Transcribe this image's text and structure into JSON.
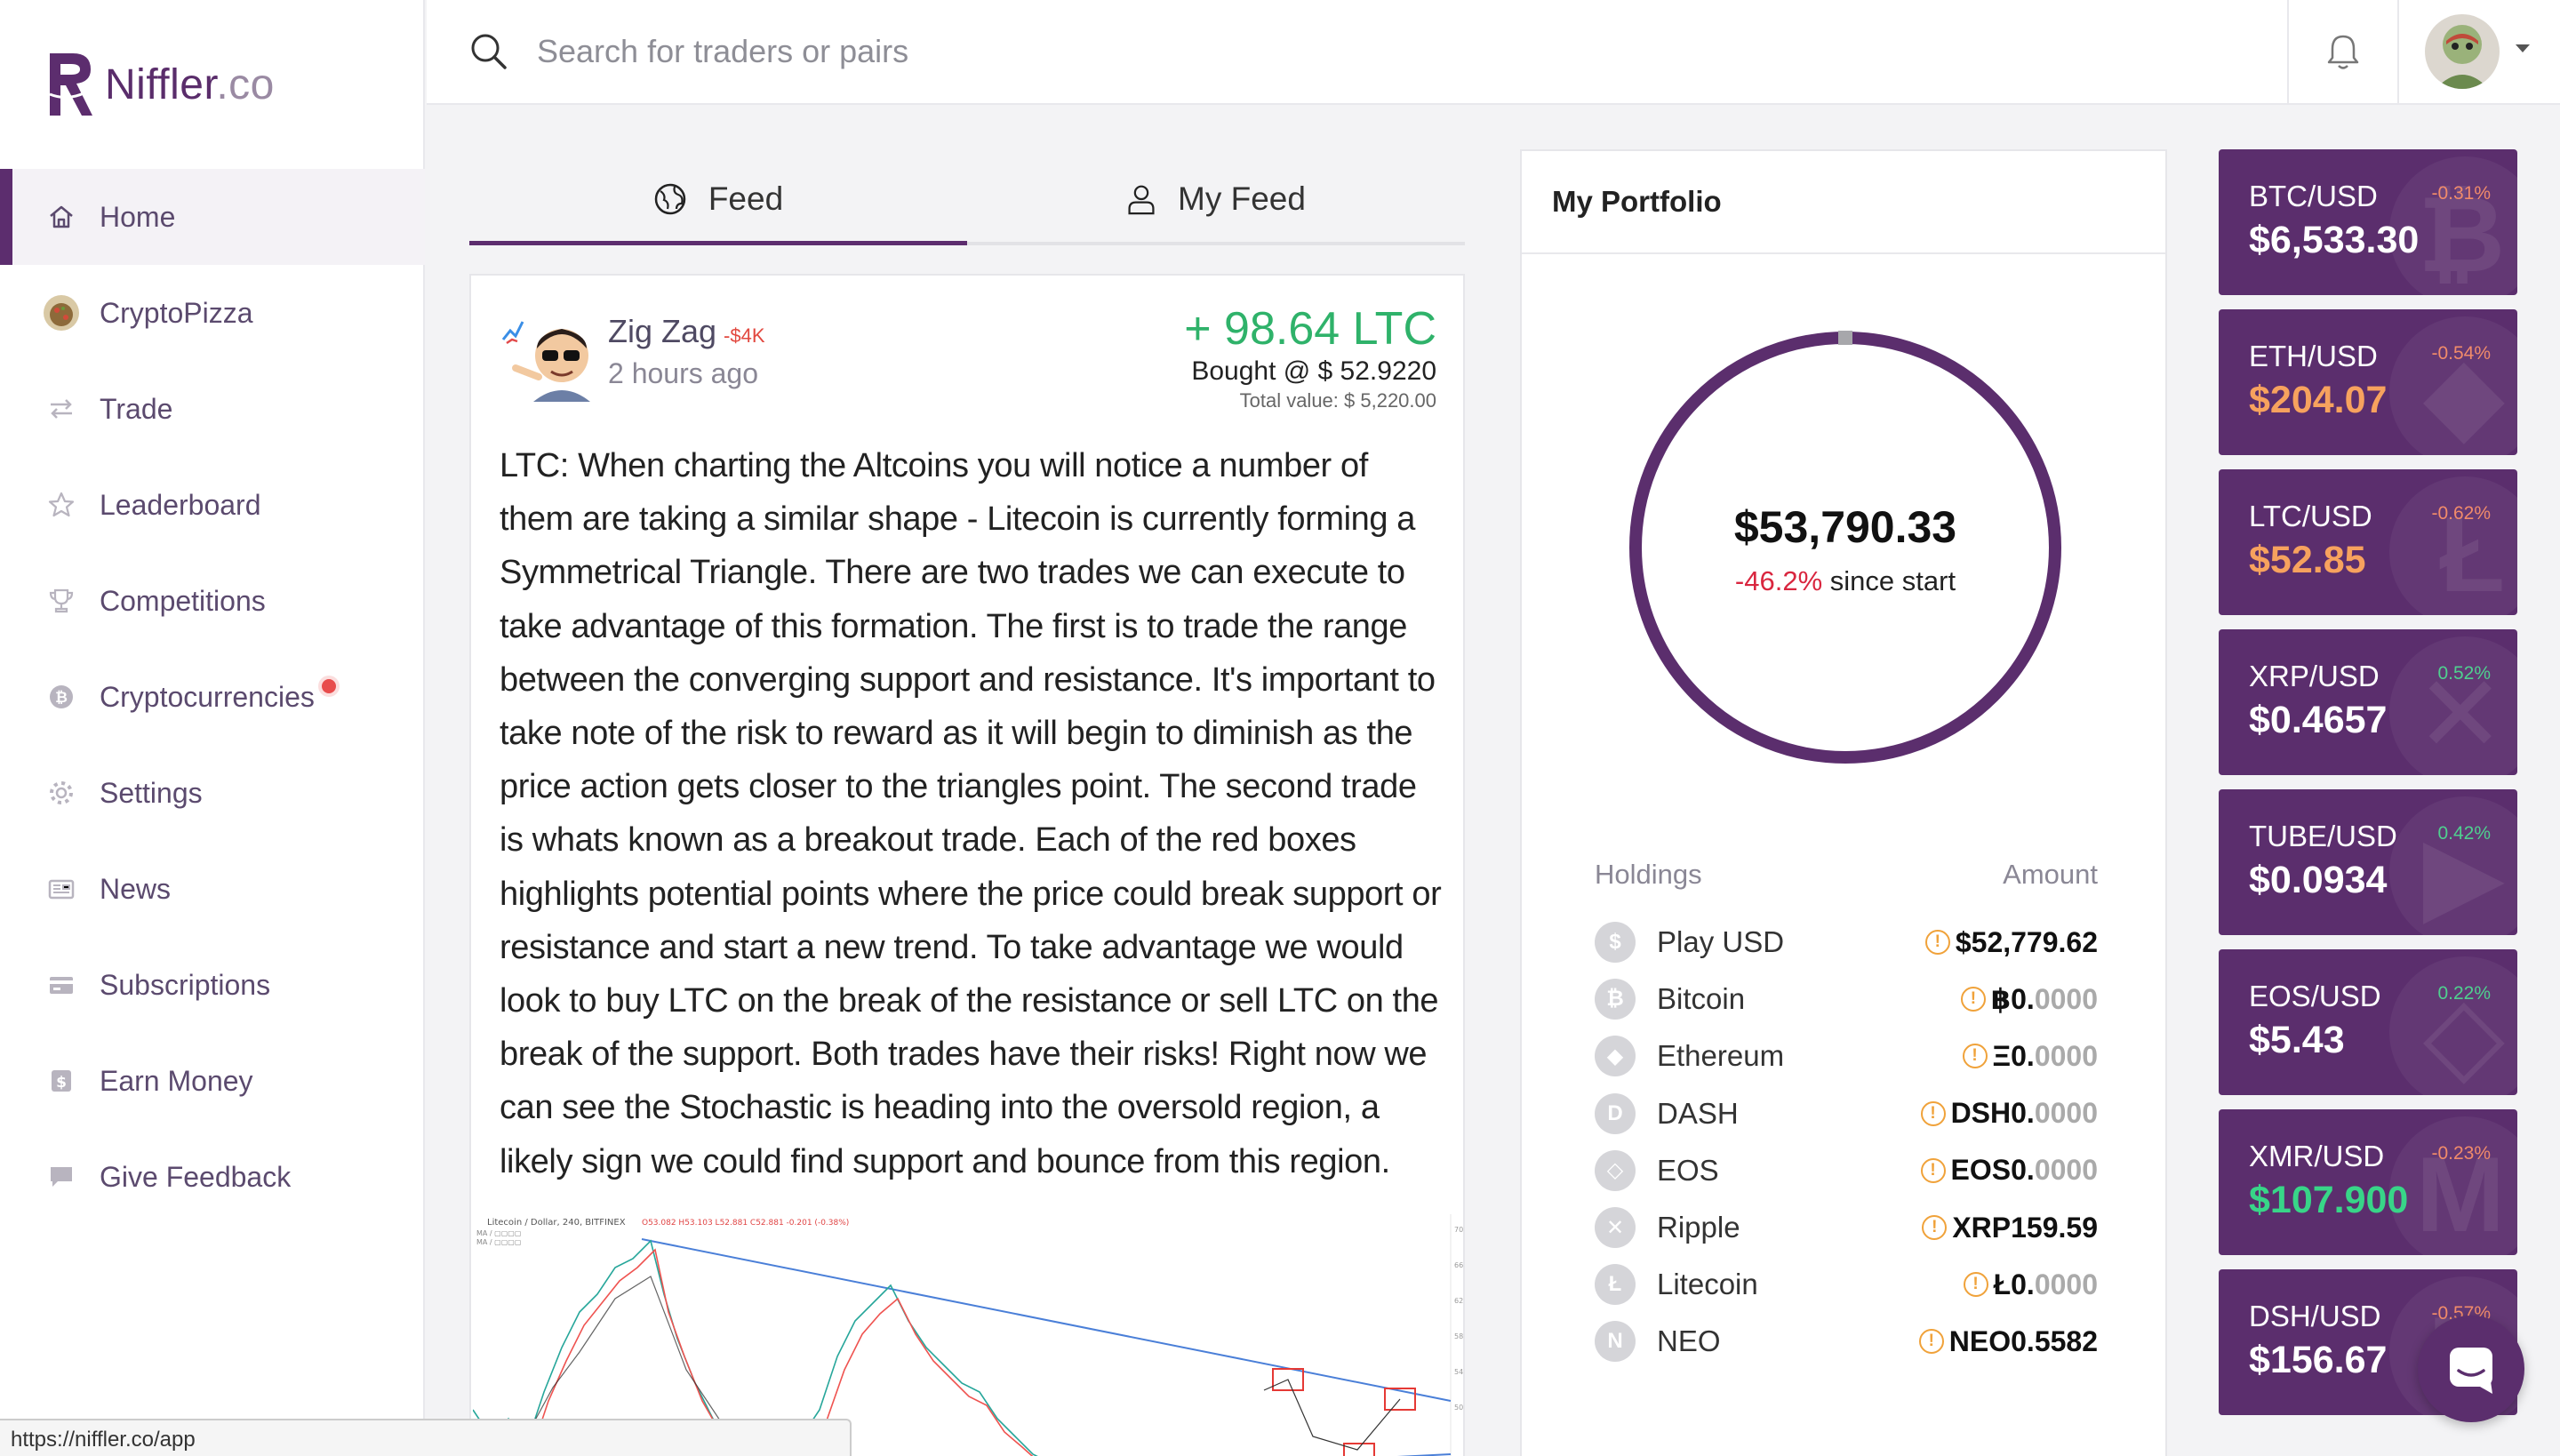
{
  "brand": {
    "name": "Niffler",
    "suffix": ".co"
  },
  "nav": [
    {
      "label": "Home",
      "icon": "home-icon",
      "active": true
    },
    {
      "label": "CryptoPizza",
      "icon": "cryptopizza-avatar-icon"
    },
    {
      "label": "Trade",
      "icon": "swap-arrows-icon"
    },
    {
      "label": "Leaderboard",
      "icon": "star-icon"
    },
    {
      "label": "Competitions",
      "icon": "trophy-icon"
    },
    {
      "label": "Cryptocurrencies",
      "icon": "bitcoin-icon",
      "badge": "red-dot"
    },
    {
      "label": "Settings",
      "icon": "gear-icon"
    },
    {
      "label": "News",
      "icon": "newspaper-icon"
    },
    {
      "label": "Subscriptions",
      "icon": "credit-card-icon"
    },
    {
      "label": "Earn Money",
      "icon": "dollar-icon"
    },
    {
      "label": "Give Feedback",
      "icon": "chat-bubble-icon"
    }
  ],
  "search": {
    "placeholder": "Search for traders or pairs"
  },
  "status_url": "https://niffler.co/app",
  "tabs": [
    {
      "label": "Feed",
      "icon": "globe-icon",
      "active": true
    },
    {
      "label": "My Feed",
      "icon": "user-icon"
    }
  ],
  "post": {
    "author": "Zig Zag",
    "author_delta": "-$4K",
    "time": "2 hours ago",
    "trade_amount": "+ 98.64 LTC",
    "bought_at": "Bought @ $ 52.9220",
    "total_value": "Total value: $ 5,220.00",
    "body": "LTC: When charting the Altcoins you will notice a number of them are taking a similar shape - Litecoin is currently forming a Symmetrical Triangle. There are two trades we can execute to take advantage of this formation. The first is to trade the range between the converging support and resistance. It's important to take note of the risk to reward as it will begin to diminish as the price action gets closer to the triangles point. The second trade is whats known as a breakout trade. Each of the red boxes highlights potential points where the price could break support or resistance and start a new trend. To take advantage we would look to buy LTC on the break of the resistance or sell LTC on the break of the support. Both trades have their risks! Right now we can see the Stochastic is heading into the oversold region, a likely sign we could find support and bounce from this region.",
    "chart_caption": "Litecoin / Dollar, 240, BITFINEX"
  },
  "portfolio": {
    "title": "My Portfolio",
    "total": "$53,790.33",
    "change": "-46.2%",
    "change_suffix": "since start",
    "holdings_label": "Holdings",
    "amount_label": "Amount",
    "holdings": [
      {
        "name": "Play USD",
        "icon": "dollar-coin-icon",
        "glyph": "$",
        "prefix": "$",
        "amount": "52,779.62",
        "dim": ""
      },
      {
        "name": "Bitcoin",
        "icon": "bitcoin-coin-icon",
        "glyph": "₿",
        "prefix": "฿",
        "amount": "0.",
        "dim": "0000"
      },
      {
        "name": "Ethereum",
        "icon": "ethereum-coin-icon",
        "glyph": "◆",
        "prefix": "Ξ",
        "amount": "0.",
        "dim": "0000"
      },
      {
        "name": "DASH",
        "icon": "dash-coin-icon",
        "glyph": "D",
        "prefix": "DSH",
        "amount": "0.",
        "dim": "0000"
      },
      {
        "name": "EOS",
        "icon": "eos-coin-icon",
        "glyph": "◇",
        "prefix": "EOS",
        "amount": "0.",
        "dim": "0000"
      },
      {
        "name": "Ripple",
        "icon": "ripple-coin-icon",
        "glyph": "✕",
        "prefix": "XRP",
        "amount": "159.59",
        "dim": ""
      },
      {
        "name": "Litecoin",
        "icon": "litecoin-coin-icon",
        "glyph": "Ł",
        "prefix": "Ł",
        "amount": "0.",
        "dim": "0000"
      },
      {
        "name": "NEO",
        "icon": "neo-coin-icon",
        "glyph": "N",
        "prefix": "NEO",
        "amount": "0.5582",
        "dim": ""
      }
    ]
  },
  "tickers": [
    {
      "pair": "BTC/USD",
      "change": "-0.31%",
      "dir": "down",
      "price": "$6,533.30",
      "price_color": "white",
      "glyph": "₿"
    },
    {
      "pair": "ETH/USD",
      "change": "-0.54%",
      "dir": "down",
      "price": "$204.07",
      "price_color": "orange",
      "glyph": "◆"
    },
    {
      "pair": "LTC/USD",
      "change": "-0.62%",
      "dir": "down",
      "price": "$52.85",
      "price_color": "orange",
      "glyph": "Ł"
    },
    {
      "pair": "XRP/USD",
      "change": "0.52%",
      "dir": "up",
      "price": "$0.4657",
      "price_color": "white",
      "glyph": "✕"
    },
    {
      "pair": "TUBE/USD",
      "change": "0.42%",
      "dir": "up",
      "price": "$0.0934",
      "price_color": "white",
      "glyph": "▶"
    },
    {
      "pair": "EOS/USD",
      "change": "0.22%",
      "dir": "up",
      "price": "$5.43",
      "price_color": "white",
      "glyph": "◇"
    },
    {
      "pair": "XMR/USD",
      "change": "-0.23%",
      "dir": "down",
      "price": "$107.900",
      "price_color": "green",
      "glyph": "M"
    },
    {
      "pair": "DSH/USD",
      "change": "-0.57%",
      "dir": "down",
      "price": "$156.67",
      "price_color": "white",
      "glyph": "D"
    }
  ],
  "colors": {
    "brand": "#5b2e6d",
    "positive": "#2fb26a",
    "negative": "#d9263f",
    "warning": "#f0a23a"
  }
}
